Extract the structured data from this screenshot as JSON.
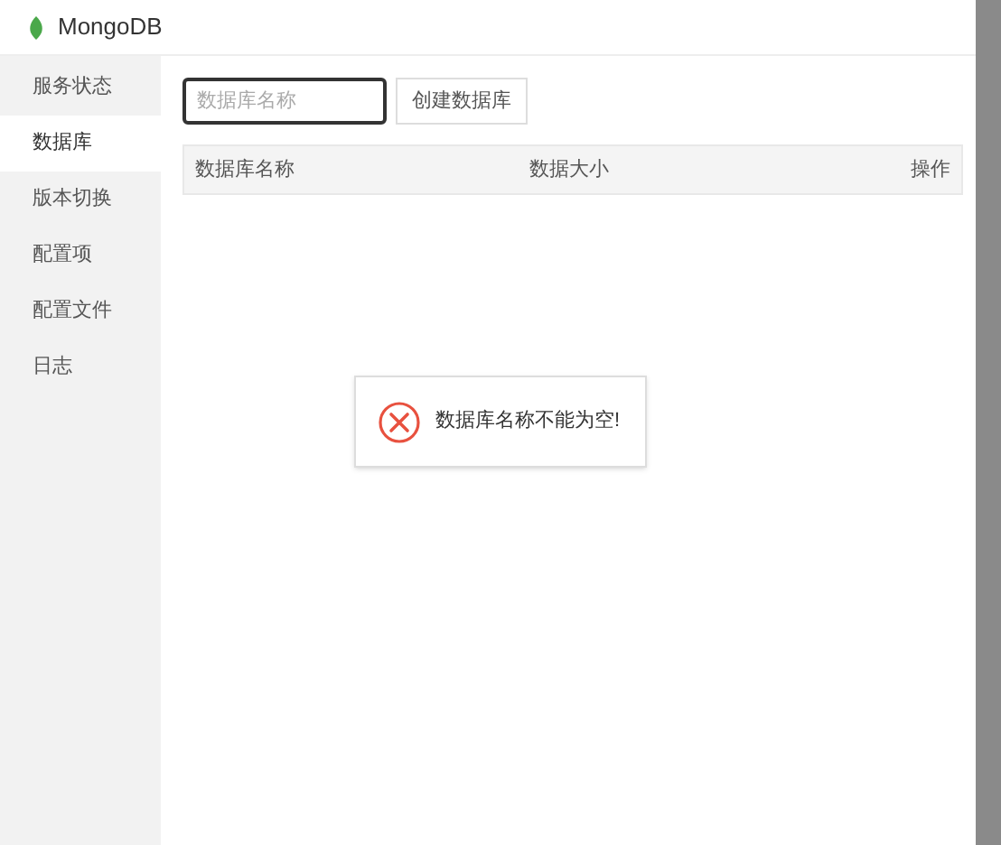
{
  "window": {
    "title": "MongoDB"
  },
  "sidebar": {
    "items": [
      {
        "label": "服务状态",
        "selected": false
      },
      {
        "label": "数据库",
        "selected": true
      },
      {
        "label": "版本切换",
        "selected": false
      },
      {
        "label": "配置项",
        "selected": false
      },
      {
        "label": "配置文件",
        "selected": false
      },
      {
        "label": "日志",
        "selected": false
      }
    ]
  },
  "toolbar": {
    "name_field": {
      "placeholder": "数据库名称"
    },
    "create_button": "创建数据库"
  },
  "table": {
    "columns": [
      "数据库名称",
      "数据大小",
      "操作"
    ]
  },
  "toast": {
    "message": "数据库名称不能为空!"
  }
}
